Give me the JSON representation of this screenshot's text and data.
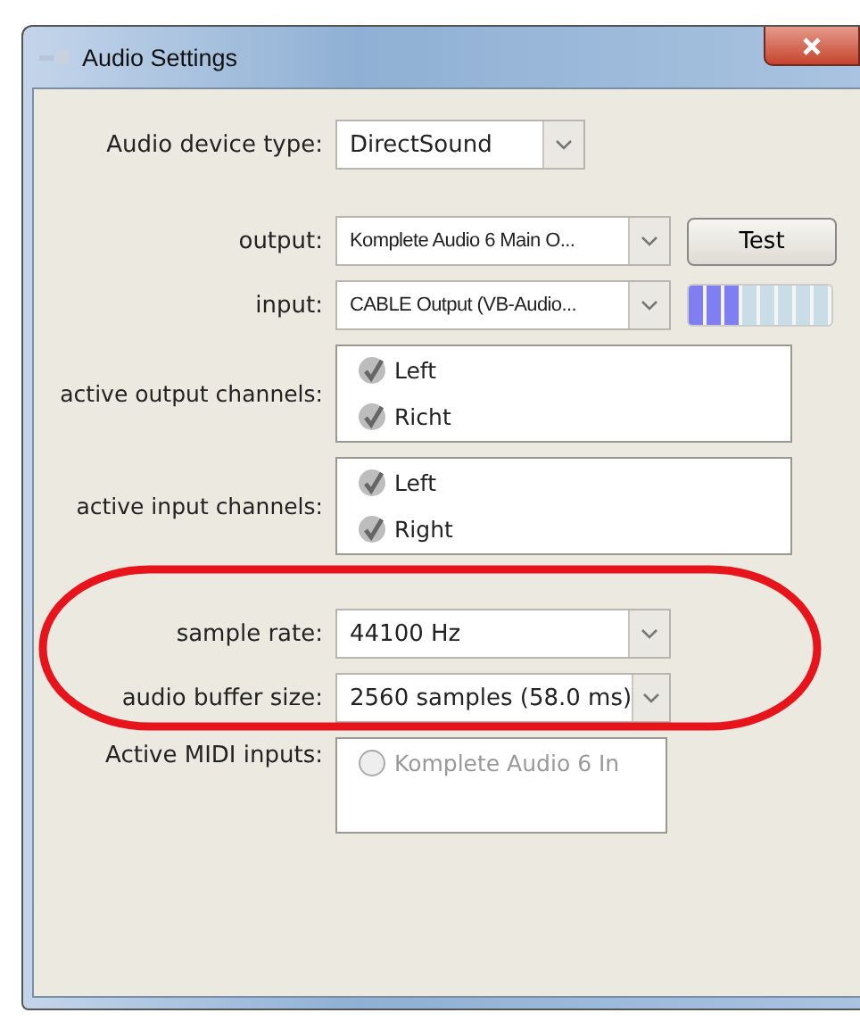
{
  "window": {
    "title": "Audio Settings"
  },
  "device_type": {
    "label": "Audio device type:",
    "value": "DirectSound"
  },
  "output": {
    "label": "output:",
    "value": "Komplete Audio 6 Main O...",
    "button": "Test"
  },
  "input": {
    "label": "input:",
    "value": "CABLE Output (VB-Audio...",
    "level": 0.375
  },
  "output_channels": {
    "label": "active output channels:",
    "items": [
      {
        "label": "Left",
        "checked": true
      },
      {
        "label": "Richt",
        "checked": true
      }
    ]
  },
  "input_channels": {
    "label": "active input channels:",
    "items": [
      {
        "label": "Left",
        "checked": true
      },
      {
        "label": "Right",
        "checked": true
      }
    ]
  },
  "sample_rate": {
    "label": "sample rate:",
    "value": "44100 Hz"
  },
  "buffer_size": {
    "label": "audio buffer size:",
    "value": "2560 samples (58.0 ms)"
  },
  "midi_inputs": {
    "label": "Active MIDI inputs:",
    "items": [
      {
        "label": "Komplete Audio 6 In",
        "checked": false,
        "disabled": true
      }
    ]
  }
}
